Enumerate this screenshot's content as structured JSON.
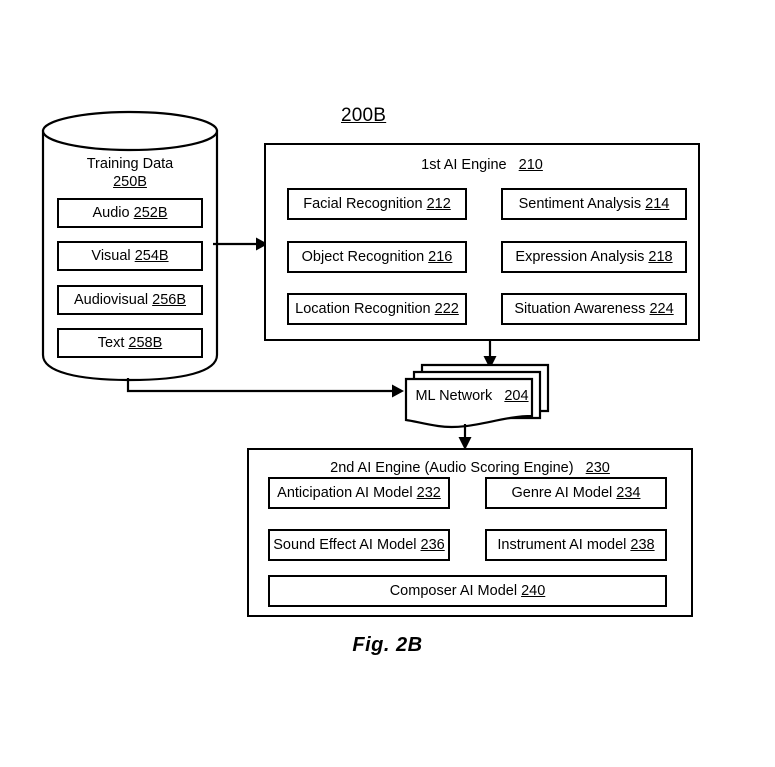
{
  "figure": {
    "ref_label": "200B",
    "caption": "Fig. 2B"
  },
  "training_data": {
    "title": "Training Data",
    "ref": "250B",
    "items": [
      {
        "label": "Audio",
        "ref": "252B"
      },
      {
        "label": "Visual",
        "ref": "254B"
      },
      {
        "label": "Audiovisual",
        "ref": "256B"
      },
      {
        "label": "Text",
        "ref": "258B"
      }
    ]
  },
  "first_engine": {
    "title": "1st AI Engine",
    "ref": "210",
    "modules": [
      {
        "label": "Facial Recognition",
        "ref": "212"
      },
      {
        "label": "Sentiment Analysis",
        "ref": "214"
      },
      {
        "label": "Object Recognition",
        "ref": "216"
      },
      {
        "label": "Expression Analysis",
        "ref": "218"
      },
      {
        "label": "Location Recognition",
        "ref": "222"
      },
      {
        "label": "Situation Awareness",
        "ref": "224"
      }
    ]
  },
  "ml_network": {
    "label": "ML Network",
    "ref": "204"
  },
  "second_engine": {
    "title": "2nd AI Engine (Audio Scoring Engine)",
    "ref": "230",
    "modules": [
      {
        "label": "Anticipation AI Model",
        "ref": "232"
      },
      {
        "label": "Genre AI Model",
        "ref": "234"
      },
      {
        "label": "Sound Effect AI Model",
        "ref": "236"
      },
      {
        "label": "Instrument AI model",
        "ref": "238"
      },
      {
        "label": "Composer AI Model",
        "ref": "240"
      }
    ]
  },
  "colors": {
    "stroke": "#000000",
    "background": "#ffffff"
  }
}
